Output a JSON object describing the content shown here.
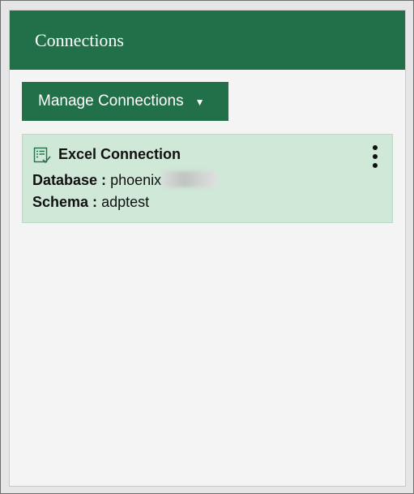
{
  "panel": {
    "title": "Connections"
  },
  "toolbar": {
    "manage_label": "Manage Connections",
    "manage_caret": "▼"
  },
  "connections": [
    {
      "name": "Excel Connection",
      "icon": "connection-checklist-icon",
      "database_label": "Database :",
      "database_value": "phoenix",
      "database_value_redacted": true,
      "schema_label": "Schema :",
      "schema_value": "adptest"
    }
  ],
  "colors": {
    "header_green": "#22704a",
    "card_green": "#cfe8d8",
    "panel_bg": "#f4f4f4"
  }
}
